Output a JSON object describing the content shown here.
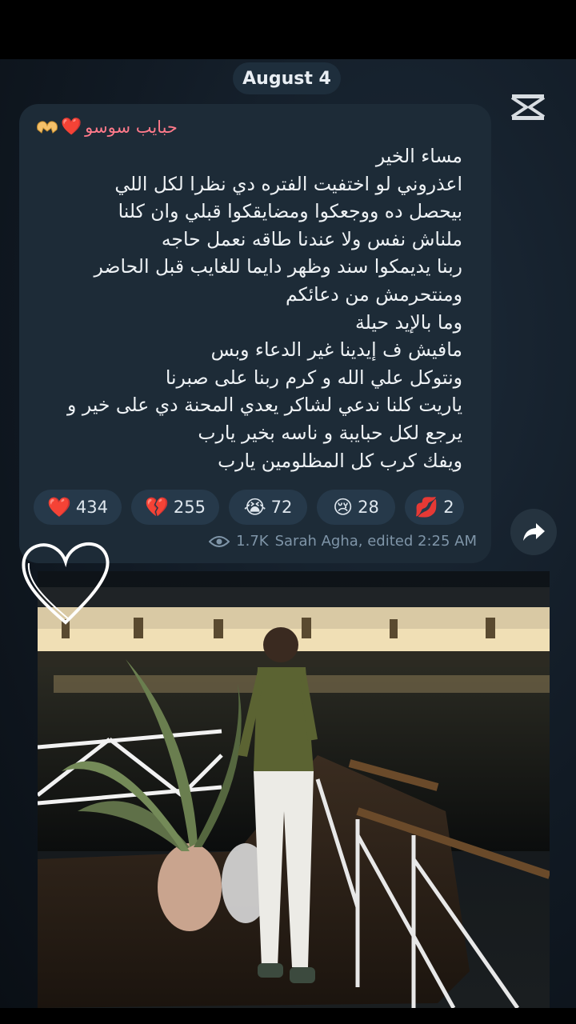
{
  "date_chip": "August 4",
  "sender": {
    "name": "حبايب سوسو",
    "emoji": "❤️"
  },
  "message_lines": [
    "مساء الخير",
    "اعذروني لو اختفيت الفتره دي نظرا لكل اللي",
    "بيحصل ده ووجعكوا ومضايقكوا قبلي وان كلنا",
    "ملناش نفس ولا عندنا طاقه نعمل حاجه",
    "ربنا يديمكوا سند وظهر دايما للغايب قبل الحاضر",
    "ومنتحرمش من دعائكم",
    "وما بالإيد حيلة",
    "مافيش ف إيدينا غير الدعاء وبس",
    "ونتوكل علي الله و كرم ربنا على صبرنا",
    "ياريت كلنا ندعي لشاكر يعدي المحنة دي على خير و",
    "يرجع لكل حبايبة و ناسه بخير يارب",
    "ويفك كرب كل المظلومين يارب"
  ],
  "reactions": [
    {
      "emoji": "❤️",
      "count": "434",
      "icon": "red-heart-icon"
    },
    {
      "emoji": "💔",
      "count": "255",
      "icon": "broken-heart-icon"
    },
    {
      "emoji": "😭",
      "count": "72",
      "icon": "loudly-crying-face-icon"
    },
    {
      "emoji": "😢",
      "count": "28",
      "icon": "crying-face-icon"
    },
    {
      "emoji": "💋",
      "count": "2",
      "icon": "kiss-mark-icon"
    }
  ],
  "views": "1.7K",
  "signature": "Sarah Agha, edited 2:25 AM",
  "colors": {
    "bubble": "#1d2b37",
    "chip": "#1e2e3c",
    "reaction_bg": "#26394a",
    "sender_name": "#ff7a8a",
    "meta_text": "#7f95a8"
  }
}
